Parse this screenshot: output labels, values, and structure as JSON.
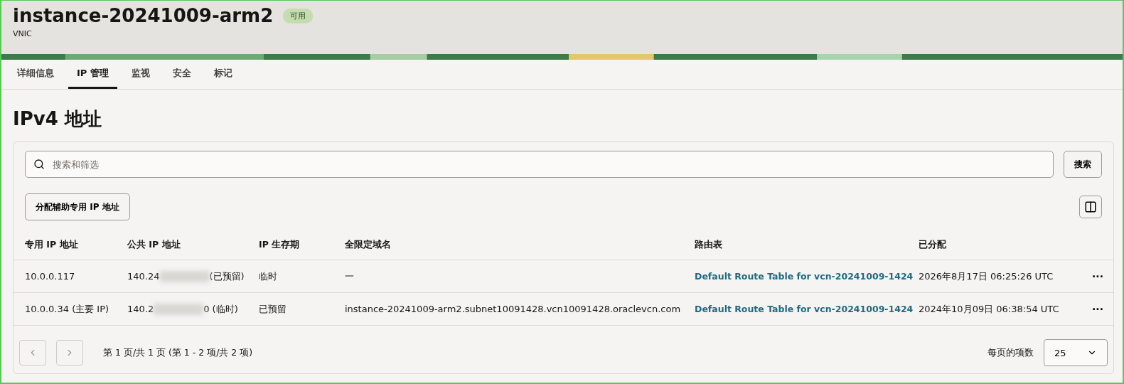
{
  "header": {
    "title": "instance-20241009-arm2",
    "status": "可用",
    "subtitle": "VNIC"
  },
  "tabs": [
    {
      "label": "详细信息",
      "selected": false
    },
    {
      "label": "IP 管理",
      "selected": true
    },
    {
      "label": "监视",
      "selected": false
    },
    {
      "label": "安全",
      "selected": false
    },
    {
      "label": "标记",
      "selected": false
    }
  ],
  "section_title": "IPv4 地址",
  "search": {
    "placeholder": "搜索和筛选",
    "button": "搜索"
  },
  "assign_button": "分配辅助专用 IP 地址",
  "table": {
    "columns": [
      "专用 IP 地址",
      "公共 IP 地址",
      "IP 生存期",
      "全限定域名",
      "路由表",
      "已分配"
    ],
    "rows": [
      {
        "private_ip": "10.0.0.117",
        "public_ip_start": "140.24",
        "public_ip_end": "(已预留)",
        "lifetime": "临时",
        "fqdn": "一",
        "route_table": "Default Route Table for vcn-20241009-1424",
        "assigned": "2026年8月17日 06:25:26 UTC",
        "actions": "···"
      },
      {
        "private_ip": "10.0.0.34 (主要 IP)",
        "public_ip_start": "140.2",
        "public_ip_end": "0 (临时)",
        "lifetime": "已预留",
        "fqdn": "instance-20241009-arm2.subnet10091428.vcn10091428.oraclevcn.com",
        "route_table": "Default Route Table for vcn-20241009-1424",
        "assigned": "2024年10月09日 06:38:54 UTC",
        "actions": "···"
      }
    ]
  },
  "pagination": {
    "summary": "第 1 页/共 1 页 (第 1 - 2 项/共 2 项)",
    "per_page_label": "每页的项数",
    "per_page": "25"
  }
}
